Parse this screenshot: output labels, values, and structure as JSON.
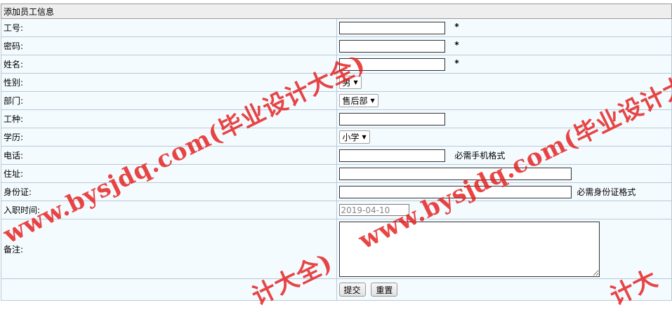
{
  "form": {
    "title": "添加员工信息",
    "labels": {
      "emp_no": "工号:",
      "password": "密码:",
      "name": "姓名:",
      "gender": "性别:",
      "dept": "部门:",
      "job": "工种:",
      "edu": "学历:",
      "phone": "电话:",
      "address": "住址:",
      "idcard": "身份证:",
      "hire_date": "入职时间:",
      "remark": "备注:"
    },
    "required_mark": "*",
    "gender_value": "男",
    "dept_value": "售后部",
    "edu_value": "小学",
    "phone_hint": "必需手机格式",
    "idcard_hint": "必需身份证格式",
    "hire_date_value": "2019-04-10",
    "submit_label": "提交",
    "reset_label": "重置"
  },
  "watermark": {
    "line1": "www.bysjdq.com(毕业设计大全)",
    "line2": "www.bysjdq.com(毕业设计大全)",
    "fragment1": "计大全)",
    "fragment2": "计大"
  },
  "colors": {
    "watermark": "#e41c1c",
    "row_bg": "#f4fbff",
    "header_bg": "#eeeeee"
  }
}
